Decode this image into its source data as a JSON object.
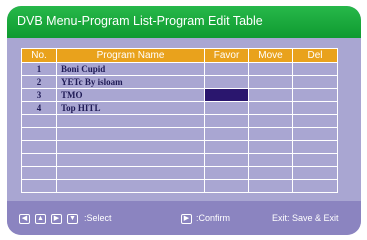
{
  "window": {
    "title": "DVB Menu-Program List-Program Edit Table"
  },
  "table": {
    "headers": [
      "No.",
      "Program Name",
      "Favor",
      "Move",
      "Del"
    ],
    "rows": [
      {
        "no": "1",
        "name": "Boni Cupid",
        "favor": false
      },
      {
        "no": "2",
        "name": "YETc By isloam",
        "favor": false
      },
      {
        "no": "3",
        "name": "TMO",
        "favor": true
      },
      {
        "no": "4",
        "name": "Top HITL",
        "favor": false
      },
      {
        "no": "",
        "name": "",
        "favor": false
      },
      {
        "no": "",
        "name": "",
        "favor": false
      },
      {
        "no": "",
        "name": "",
        "favor": false
      },
      {
        "no": "",
        "name": "",
        "favor": false
      },
      {
        "no": "",
        "name": "",
        "favor": false
      },
      {
        "no": "",
        "name": "",
        "favor": false
      }
    ]
  },
  "footer": {
    "nav_icons": [
      "arrow-left-icon",
      "arrow-up-icon",
      "arrow-right-icon",
      "arrow-down-icon"
    ],
    "select_label": ":Select",
    "confirm_icon": "play-icon",
    "confirm_label": ":Confirm",
    "exit_label": "Exit: Save & Exit"
  },
  "colors": {
    "title_bar": "#1ea83e",
    "panel": "#a9a6d2",
    "header_cell": "#e9a21c",
    "favor_marker": "#2a166e"
  }
}
